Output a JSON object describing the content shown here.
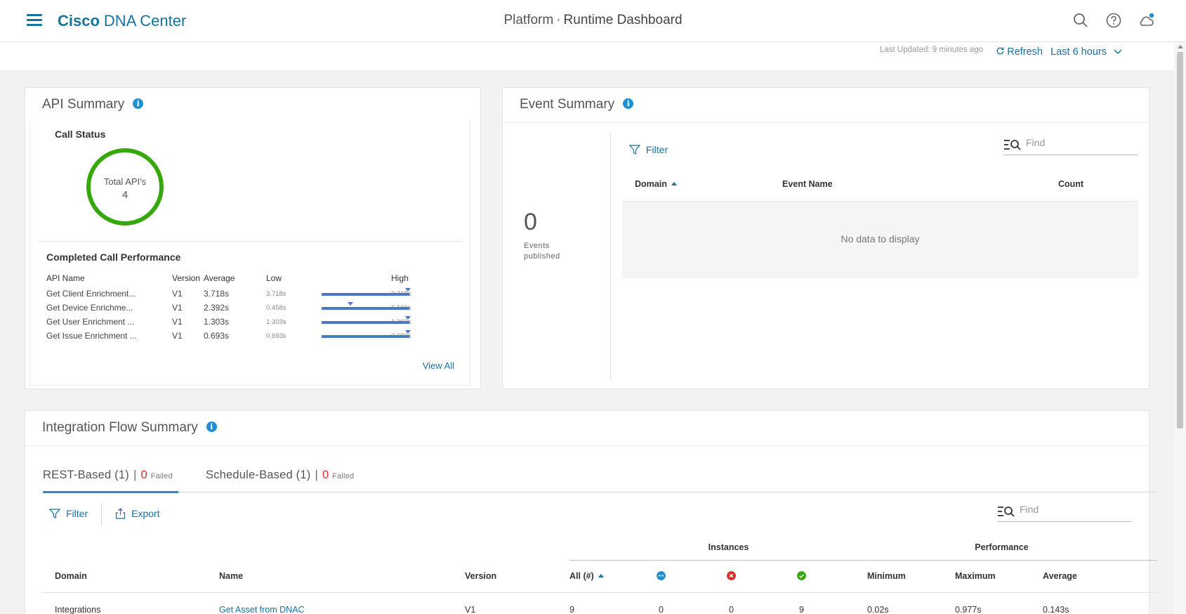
{
  "header": {
    "brand_bold": "Cisco",
    "brand_rest": "DNA Center",
    "breadcrumb": "Platform",
    "separator": "·",
    "title": "Runtime Dashboard"
  },
  "toolbar": {
    "last_updated": "Last Updated: 9 minutes ago",
    "refresh_label": "Refresh",
    "time_range": "Last 6 hours"
  },
  "api_summary": {
    "title": "API Summary",
    "call_status_title": "Call Status",
    "donut_label": "Total API's",
    "donut_value": "4",
    "completed_title": "Completed Call Performance",
    "columns": [
      "API Name",
      "Version",
      "Average",
      "Low",
      "High"
    ],
    "rows": [
      {
        "name": "Get Client Enrichment...",
        "version": "V1",
        "average": "3.718s",
        "low": "3.718s",
        "high": "3.718s",
        "marker": 1.0
      },
      {
        "name": "Get Device Enrichme...",
        "version": "V1",
        "average": "2.392s",
        "low": "0.458s",
        "high": "6.101s",
        "marker": 0.343
      },
      {
        "name": "Get User Enrichment ...",
        "version": "V1",
        "average": "1.303s",
        "low": "1.303s",
        "high": "1.303s",
        "marker": 1.0
      },
      {
        "name": "Get Issue Enrichment ...",
        "version": "V1",
        "average": "0.693s",
        "low": "0.693s",
        "high": "0.693s",
        "marker": 1.0
      }
    ],
    "view_all": "View All"
  },
  "event_summary": {
    "title": "Event Summary",
    "count": "0",
    "count_caption": "Events published",
    "filter_label": "Filter",
    "find_placeholder": "Find",
    "columns": {
      "domain": "Domain",
      "event_name": "Event Name",
      "count": "Count"
    },
    "empty_text": "No data to display"
  },
  "integration_flow": {
    "title": "Integration Flow Summary",
    "tabs": [
      {
        "label": "REST-Based (1)",
        "failed_count": "0",
        "failed_label": "Failed"
      },
      {
        "label": "Schedule-Based (1)",
        "failed_count": "0",
        "failed_label": "Failed"
      }
    ],
    "filter_label": "Filter",
    "export_label": "Export",
    "find_placeholder": "Find",
    "group_instances": "Instances",
    "group_performance": "Performance",
    "columns": {
      "domain": "Domain",
      "name": "Name",
      "version": "Version",
      "all": "All (#)",
      "minimum": "Minimum",
      "maximum": "Maximum",
      "average": "Average"
    },
    "rows": [
      {
        "domain": "Integrations",
        "name": "Get Asset from DNAC",
        "version": "V1",
        "all": "9",
        "in_progress": "0",
        "failed": "0",
        "success": "9",
        "minimum": "0.02s",
        "maximum": "0.977s",
        "average": "0.143s"
      }
    ]
  },
  "colors": {
    "accent": "#1572a1",
    "success": "#36a80e",
    "error": "#d93025",
    "bar": "#4b77c9"
  }
}
